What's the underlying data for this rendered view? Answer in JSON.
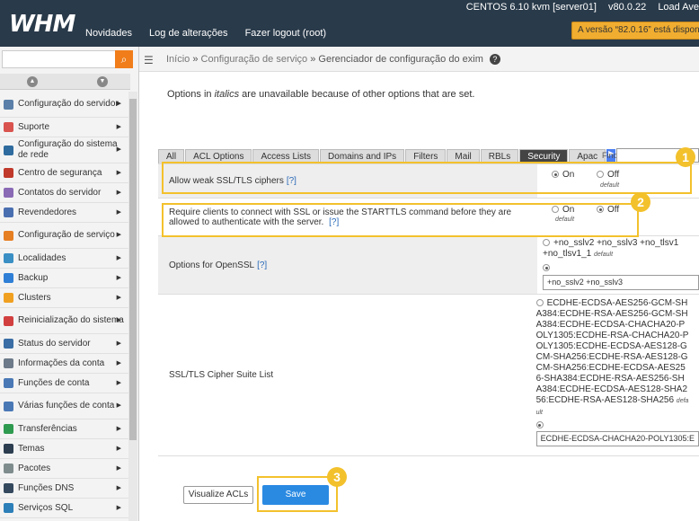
{
  "header": {
    "logo": "WHM",
    "nav": [
      "Novidades",
      "Log de alterações",
      "Fazer logout (root)"
    ],
    "os": "CENTOS 6.10 kvm [server01]",
    "version": "v80.0.22",
    "load": "Load Ave",
    "upgrade_notice": "A versão “82.0.16” está dispon"
  },
  "sidebar": {
    "search_placeholder": "",
    "items": [
      {
        "label": "Configuração do servidor",
        "icon": "server-config-icon",
        "color": "#5a7fa8"
      },
      {
        "label": "Suporte",
        "icon": "support-icon",
        "color": "#d9534f"
      },
      {
        "label": "Configuração do sistema de rede",
        "icon": "network-icon",
        "color": "#2e6b9e"
      },
      {
        "label": "Centro de segurança",
        "icon": "security-icon",
        "color": "#c0392b"
      },
      {
        "label": "Contatos do servidor",
        "icon": "contacts-icon",
        "color": "#8a6ab5"
      },
      {
        "label": "Revendedores",
        "icon": "resellers-icon",
        "color": "#4a6fb0"
      },
      {
        "label": "Configuração de serviço",
        "icon": "service-config-icon",
        "color": "#e67e22"
      },
      {
        "label": "Localidades",
        "icon": "locales-icon",
        "color": "#3a8fc4"
      },
      {
        "label": "Backup",
        "icon": "backup-icon",
        "color": "#2f7fd6"
      },
      {
        "label": "Clusters",
        "icon": "clusters-icon",
        "color": "#f0a020"
      },
      {
        "label": "Reinicialização do sistema",
        "icon": "restart-icon",
        "color": "#d23f3f"
      },
      {
        "label": "Status do servidor",
        "icon": "status-icon",
        "color": "#3a6ea5"
      },
      {
        "label": "Informações da conta",
        "icon": "account-info-icon",
        "color": "#6c7a89"
      },
      {
        "label": "Funções de conta",
        "icon": "account-functions-icon",
        "color": "#4a78b5"
      },
      {
        "label": "Várias funções de conta",
        "icon": "multi-account-icon",
        "color": "#4a78b5"
      },
      {
        "label": "Transferências",
        "icon": "transfers-icon",
        "color": "#2e9a4f"
      },
      {
        "label": "Temas",
        "icon": "themes-icon",
        "color": "#2c3e50"
      },
      {
        "label": "Pacotes",
        "icon": "packages-icon",
        "color": "#7f8c8d"
      },
      {
        "label": "Funções DNS",
        "icon": "dns-icon",
        "color": "#34495e"
      },
      {
        "label": "Serviços SQL",
        "icon": "sql-icon",
        "color": "#2c7fb8"
      }
    ]
  },
  "breadcrumb": {
    "home": "Início",
    "section": "Configuração de serviço",
    "current": "Gerenciador de configuração do exim",
    "sep": "»"
  },
  "intro_prefix": "Options in ",
  "intro_italic": "italics",
  "intro_suffix": " are unavailable because of other options that are set.",
  "tabs": [
    "All",
    "ACL Options",
    "Access Lists",
    "Domains and IPs",
    "Filters",
    "Mail",
    "RBLs",
    "Security",
    "Apac"
  ],
  "active_tab": "Security",
  "find_label": "Find",
  "settings": [
    {
      "label": "Allow weak SSL/TLS ciphers",
      "help": "[?]",
      "on_label": "On",
      "off_label": "Off",
      "selected": "on",
      "default_under": "off",
      "default_text": "default"
    },
    {
      "label": "Require clients to connect with SSL or issue the STARTTLS command before they are allowed to authenticate with the server.",
      "help": "[?]",
      "on_label": "On",
      "off_label": "Off",
      "selected": "off",
      "default_under": "on",
      "default_text": "default"
    },
    {
      "label": "Options for OpenSSL",
      "help": "[?]",
      "default_value": "+no_sslv2 +no_sslv3 +no_tlsv1 +no_tlsv1_1",
      "default_text": "default",
      "custom_value": "+no_sslv2 +no_sslv3"
    },
    {
      "label": "SSL/TLS Cipher Suite List",
      "help": "",
      "default_value": "ECDHE-ECDSA-AES256-GCM-SHA384:ECDHE-RSA-AES256-GCM-SHA384:ECDHE-ECDSA-CHACHA20-POLY1305:ECDHE-RSA-CHACHA20-POLY1305:ECDHE-ECDSA-AES128-GCM-SHA256:ECDHE-RSA-AES128-GCM-SHA256:ECDHE-ECDSA-AES256-SHA384:ECDHE-RSA-AES256-SHA384:ECDHE-ECDSA-AES128-SHA256:ECDHE-RSA-AES128-SHA256",
      "default_text": "default",
      "custom_value": "ECDHE-ECDSA-CHACHA20-POLY1305:E"
    }
  ],
  "buttons": {
    "visualize": "Visualize ACLs",
    "save": "Save"
  },
  "annotations": [
    "1",
    "2",
    "3"
  ],
  "colors": {
    "highlight": "#f3c12c",
    "header": "#293a4a",
    "save": "#2a8ae2",
    "search_button": "#f07d1a"
  }
}
